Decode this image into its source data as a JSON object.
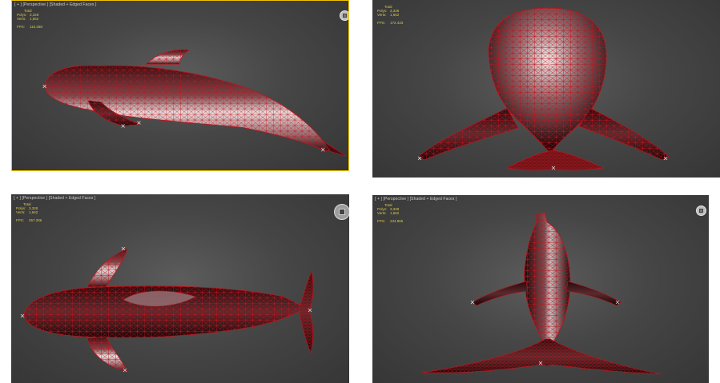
{
  "viewports": [
    {
      "label": "[ + ] [Perspective ] [Shaded + Edged Faces ]",
      "stats": {
        "header": "Total",
        "polys_label": "Polys:",
        "polys_value": "3,328",
        "verts_label": "Verts:",
        "verts_value": "1,662",
        "fps_label": "FPS:",
        "fps_value": "116.288"
      },
      "icon": "viewcube-icon"
    },
    {
      "label": "",
      "stats": {
        "header": "Total",
        "polys_label": "Polys:",
        "polys_value": "3,328",
        "verts_label": "Verts:",
        "verts_value": "1,662",
        "fps_label": "FPS:",
        "fps_value": "172.433"
      },
      "icon": ""
    },
    {
      "label": "[ + ] [Perspective ] [Shaded + Edged Faces ]",
      "stats": {
        "header": "Total",
        "polys_label": "Polys:",
        "polys_value": "3,328",
        "verts_label": "Verts:",
        "verts_value": "1,662",
        "fps_label": "FPS:",
        "fps_value": "257.286"
      },
      "icon": "viewcube-icon"
    },
    {
      "label": "[ + ] [Perspective ] [Shaded + Edged Faces ]",
      "stats": {
        "header": "Total",
        "polys_label": "Polys:",
        "polys_value": "3,328",
        "verts_label": "Verts:",
        "verts_value": "1,662",
        "fps_label": "FPS:",
        "fps_value": "234.865"
      },
      "icon": "viewcube-icon"
    }
  ],
  "colors": {
    "viewport_bg": "#464646",
    "active_border": "#f2c200",
    "wire": "#c0141c",
    "stats_text": "#d9c84a"
  }
}
